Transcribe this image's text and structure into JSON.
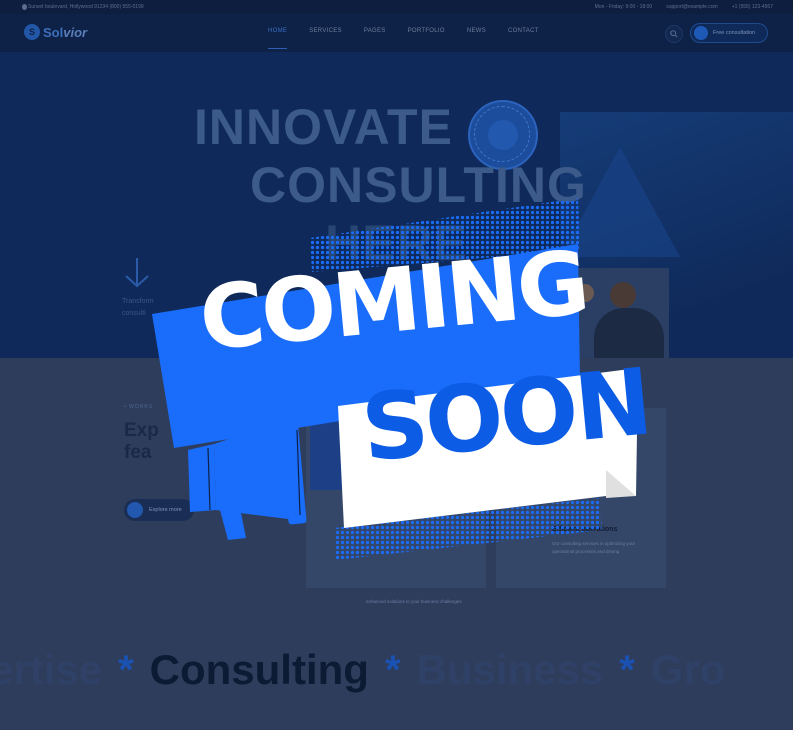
{
  "topbar": {
    "address": "Sunset boulevard, Hollywood 91234 (800) 555-0199",
    "hours": "Mon - Friday: 9:00 - 18:00",
    "email": "support@example.com",
    "phone": "+1 (555) 123-4567"
  },
  "brand": {
    "logo_main": "Sol",
    "logo_accent": "vior"
  },
  "nav": {
    "items": [
      "Home",
      "Services",
      "Pages",
      "Portfolio",
      "News",
      "Contact"
    ],
    "cta_label": "Free consultation"
  },
  "hero": {
    "line1": "INNOVATE",
    "line2": "CONSULTING",
    "line3": "HERE",
    "subtitle_1": "Transform",
    "subtitle_2": "consulti"
  },
  "section": {
    "tagline": "• WORKS",
    "title_1": "Exp",
    "title_1b": "r core",
    "title_2": "fea",
    "explore_label": "Explore more",
    "card_title": "Efficient operations",
    "card_desc": "Our consulting services in optimizing your operational processes and driving",
    "card1_desc": "enhanced solutions to your business challenges"
  },
  "ticker": {
    "words": [
      "ertise",
      "Consulting",
      "Business",
      "Gro"
    ],
    "separator": "*"
  },
  "overlay": {
    "coming": "COMING",
    "soon": "SOON"
  },
  "colors": {
    "accent_blue": "#0c5ce6",
    "banner_blue": "#1a6dfa",
    "dark_navy": "#0e2146"
  }
}
